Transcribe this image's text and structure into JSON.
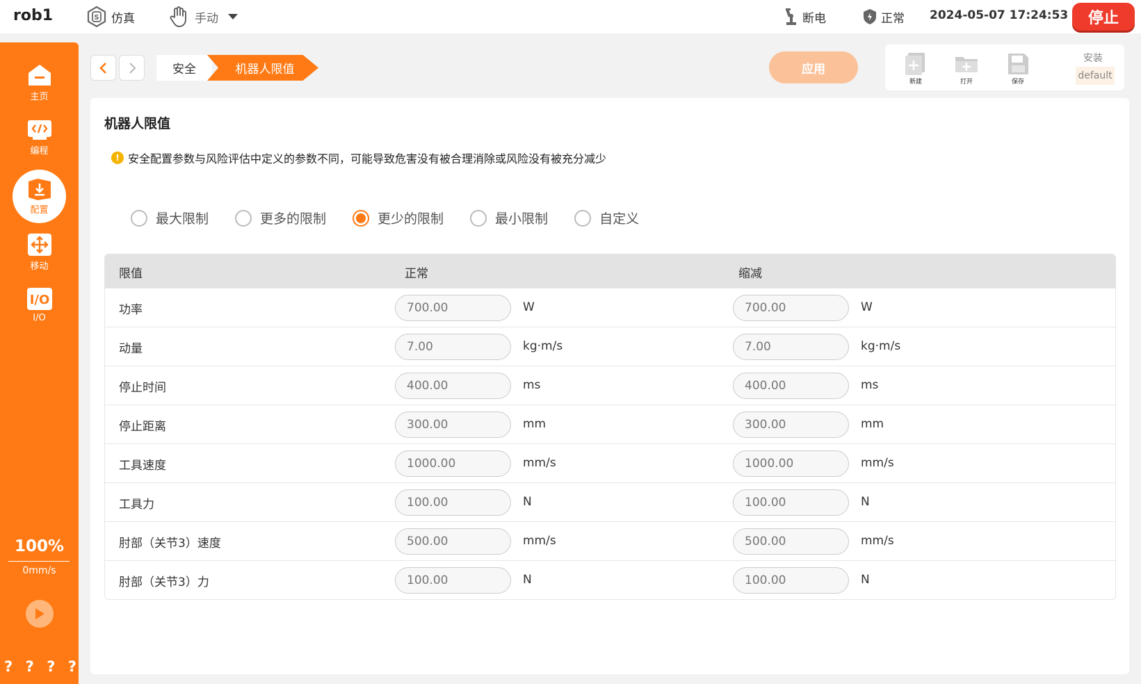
{
  "topbar": {
    "robot_name": "rob1",
    "mode": "仿真",
    "control": "手动",
    "power": "断电",
    "status": "正常",
    "datetime": "2024-05-07 17:24:53",
    "stop_label": "停止"
  },
  "sidebar": {
    "items": [
      {
        "label": "主页",
        "icon": "home-icon"
      },
      {
        "label": "编程",
        "icon": "code-icon"
      },
      {
        "label": "配置",
        "icon": "config-icon"
      },
      {
        "label": "移动",
        "icon": "move-icon"
      },
      {
        "label": "I/O",
        "icon": "io-icon"
      }
    ],
    "speed_percent": "100%",
    "speed_value": "0mm/s",
    "qmarks": [
      "?",
      "?",
      "?",
      "?"
    ]
  },
  "breadcrumb": {
    "items": [
      "安全",
      "机器人限值"
    ]
  },
  "toolbar": {
    "apply_label": "应用",
    "new_label": "新建",
    "open_label": "打开",
    "save_label": "保存",
    "install_label": "安装",
    "install_value": "default"
  },
  "content": {
    "title": "机器人限值",
    "warning": "安全配置参数与风险评估中定义的参数不同，可能导致危害没有被合理消除或风险没有被充分减少",
    "presets": [
      "最大限制",
      "更多的限制",
      "更少的限制",
      "最小限制",
      "自定义"
    ],
    "selected_preset": "更少的限制",
    "columns": [
      "限值",
      "正常",
      "缩减"
    ],
    "rows": [
      {
        "name": "功率",
        "normal": "700.00",
        "reduced": "700.00",
        "unit": "W"
      },
      {
        "name": "动量",
        "normal": "7.00",
        "reduced": "7.00",
        "unit": "kg·m/s"
      },
      {
        "name": "停止时间",
        "normal": "400.00",
        "reduced": "400.00",
        "unit": "ms"
      },
      {
        "name": "停止距离",
        "normal": "300.00",
        "reduced": "300.00",
        "unit": "mm"
      },
      {
        "name": "工具速度",
        "normal": "1000.00",
        "reduced": "1000.00",
        "unit": "mm/s"
      },
      {
        "name": "工具力",
        "normal": "100.00",
        "reduced": "100.00",
        "unit": "N"
      },
      {
        "name": "肘部（关节3）速度",
        "normal": "500.00",
        "reduced": "500.00",
        "unit": "mm/s"
      },
      {
        "name": "肘部（关节3）力",
        "normal": "100.00",
        "reduced": "100.00",
        "unit": "N"
      }
    ]
  },
  "colors": {
    "accent": "#ff7a14",
    "stop": "#ee3b2b",
    "apply_disabled": "#fbc29a",
    "warning": "#f5b400"
  }
}
